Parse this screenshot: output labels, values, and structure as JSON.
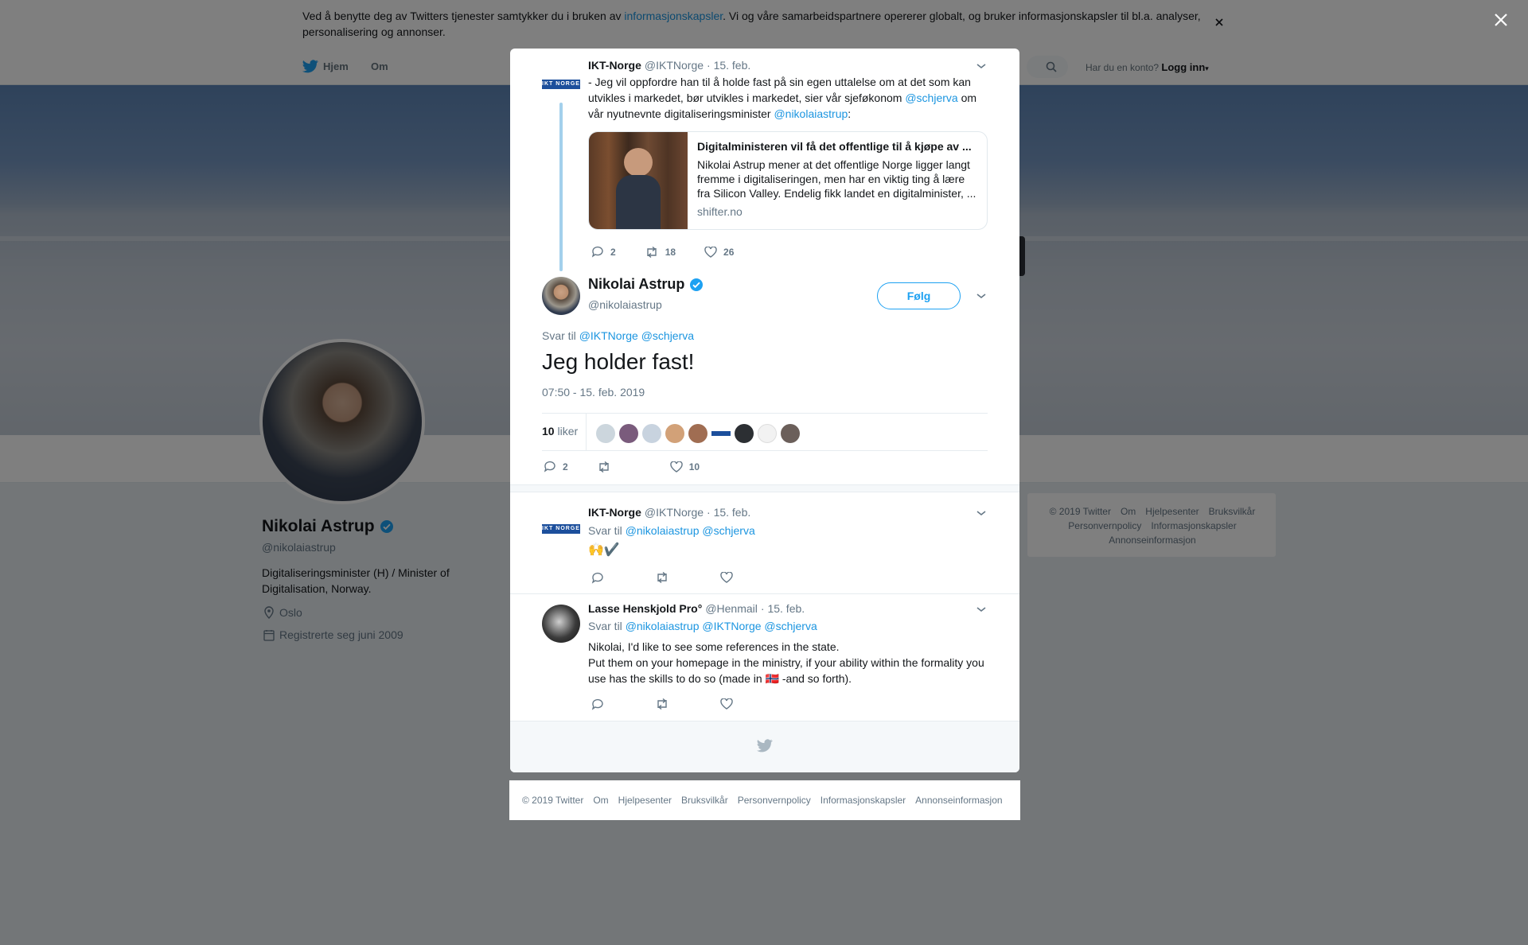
{
  "cookie_banner": {
    "text_before": "Ved å benytte deg av Twitters tjenester samtykker du i bruken av ",
    "link": "informasjonskapsler",
    "text_after": ". Vi og våre samarbeidspartnere opererer globalt, og bruker informasjonskapsler til bl.a. analyser, personalisering og annonser."
  },
  "nav": {
    "home": "Hjem",
    "about": "Om",
    "have_account": "Har du en konto?",
    "login": "Logg inn"
  },
  "profile": {
    "name": "Nikolai Astrup",
    "handle": "@nikolaiastrup",
    "bio": "Digitaliseringsminister (H) / Minister of Digitalisation, Norway.",
    "location": "Oslo",
    "joined": "Registrerte seg juni 2009"
  },
  "side_footer": [
    "© 2019 Twitter",
    "Om",
    "Hjelpesenter",
    "Bruksvilkår",
    "Personvernpolicy",
    "Informasjonskapsler",
    "Annonseinformasjon"
  ],
  "parent_tweet": {
    "name": "IKT-Norge",
    "handle": "@IKTNorge",
    "date": "· 15. feb.",
    "text_1": "- Jeg vil oppfordre han til å holde fast på sin egen uttalelse om at det som kan utvikles i markedet, bør utvikles i markedet, sier vår sjeføkonom ",
    "mention_1": "@schjerva",
    "text_2": " om vår nyutnevnte digitaliseringsminister ",
    "mention_2": "@nikolaiastrup",
    "text_3": ":",
    "card": {
      "title": "Digitalministeren vil få det offentlige til å kjøpe av ...",
      "description": "Nikolai Astrup mener at det offentlige Norge ligger langt fremme i digitaliseringen, men har en viktig ting å lære fra Silicon Valley. Endelig fikk landet en digitalminister, ...",
      "domain": "shifter.no"
    },
    "replies": "2",
    "retweets": "18",
    "likes": "26"
  },
  "main_tweet": {
    "name": "Nikolai Astrup",
    "handle": "@nikolaiastrup",
    "follow": "Følg",
    "reply_to_label": "Svar til",
    "reply_to_1": "@IKTNorge",
    "reply_to_2": "@schjerva",
    "text": "Jeg holder fast!",
    "timestamp": "07:50 - 15. feb. 2019",
    "likes_count": "10",
    "likes_label": "liker",
    "replies": "2",
    "retweets": "",
    "likes": "10"
  },
  "reply_1": {
    "name": "IKT-Norge",
    "handle": "@IKTNorge",
    "date": "· 15. feb.",
    "reply_to_label": "Svar til",
    "reply_to_1": "@nikolaiastrup",
    "reply_to_2": "@schjerva",
    "text": "🙌✔️"
  },
  "reply_2": {
    "name": "Lasse Henskjold Pro°",
    "handle": "@Henmail",
    "date": "· 15. feb.",
    "reply_to_label": "Svar til",
    "reply_to_1": "@nikolaiastrup",
    "reply_to_2": "@IKTNorge",
    "reply_to_3": "@schjerva",
    "line_1": "Nikolai, I'd like to see some references in the state.",
    "line_2": "Put them on your homepage in the ministry, if your ability within  the formality you use has the skills to do so (made in ",
    "flag": "🇳🇴",
    "line_2_end": " -and so forth)."
  },
  "modal_footer": [
    "© 2019 Twitter",
    "Om",
    "Hjelpesenter",
    "Bruksvilkår",
    "Personvernpolicy",
    "Informasjonskapsler",
    "Annonseinformasjon"
  ],
  "iktnorge_logo_text": "IKT NORGE",
  "colors": {
    "accent": "#1b95e0",
    "verified": "#1da1f2",
    "thread_line": "#a3d0ec"
  }
}
